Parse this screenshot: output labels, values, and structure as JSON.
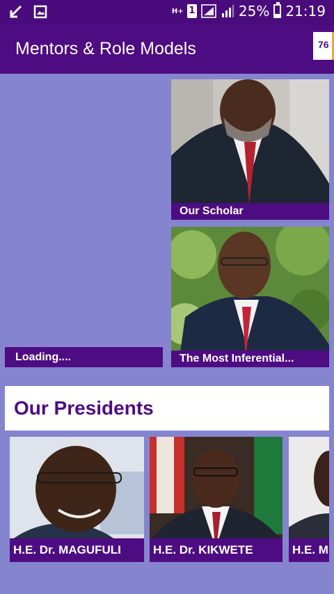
{
  "status_bar": {
    "network": "H+",
    "sim": "1",
    "battery": "25%",
    "time": "21:19",
    "icons": [
      "missed-call-icon",
      "gallery-icon",
      "signal-icon",
      "wifi-signal-icon",
      "battery-icon"
    ]
  },
  "app_bar": {
    "title": "Mentors & Role Models",
    "badge": "76"
  },
  "mentors": [
    {
      "caption": "Loading...."
    },
    {
      "caption": "Our Scholar"
    },
    {
      "caption": "The Most Inferential..."
    }
  ],
  "presidents_section": {
    "title": "Our Presidents",
    "items": [
      {
        "caption": "H.E. Dr. MAGUFULI"
      },
      {
        "caption": "H.E. Dr. KIKWETE"
      },
      {
        "caption": "H.E. M"
      }
    ]
  },
  "colors": {
    "background": "#8584cf",
    "primary": "#4e0c82",
    "status_bar": "#4a0c7d",
    "badge_accent": "#f2a33a"
  }
}
